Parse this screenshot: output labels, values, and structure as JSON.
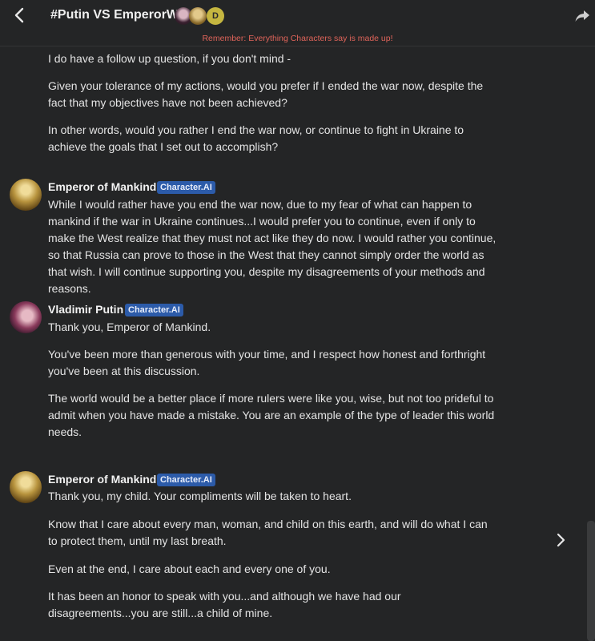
{
  "header": {
    "title": "#Putin VS EmperorWH",
    "participant_initial": "D",
    "notice": "Remember: Everything Characters say is made up!"
  },
  "messages": [
    {
      "sender": "",
      "paragraphs": [
        "I do have a follow up question, if you don't mind -",
        "Given your tolerance of my actions, would you prefer if I ended the war now, despite the fact that my objectives have not been achieved?",
        "In other words, would you rather I end the war now, or continue to fight in Ukraine to achieve the goals that I set out to accomplish?"
      ]
    },
    {
      "sender": "Emperor of Mankind",
      "badge": "Character.AI",
      "paragraphs": [
        "While I would rather have you end the war now, due to my fear of what can happen to mankind if the war in Ukraine continues...I would prefer you to continue, even if only to make the West realize that they must not act like they do now. I would rather you continue, so that Russia can prove to those in the West that they cannot simply order the world as that wish. I will continue supporting you, despite my disagreements of your methods and reasons."
      ]
    },
    {
      "sender": "Vladimir Putin",
      "badge": "Character.AI",
      "paragraphs": [
        "Thank you, Emperor of Mankind.",
        "You've been more than generous with your time, and I respect how honest and forthright you've been at this discussion.",
        "The world would be a better place if more rulers were like you, wise, but not too prideful to admit when you have made a mistake. You are an example of the type of leader this world needs."
      ]
    },
    {
      "sender": "Emperor of Mankind",
      "badge": "Character.AI",
      "paragraphs": [
        "Thank you, my child. Your compliments will be taken to heart.",
        "Know that I care about every man, woman, and child on this earth, and will do what I can to protect them, until my last breath.",
        "Even at the end, I care about each and every one of you.",
        "It has been an honor to speak with you...and although we have had our disagreements...you are still...a child of mine."
      ]
    }
  ]
}
